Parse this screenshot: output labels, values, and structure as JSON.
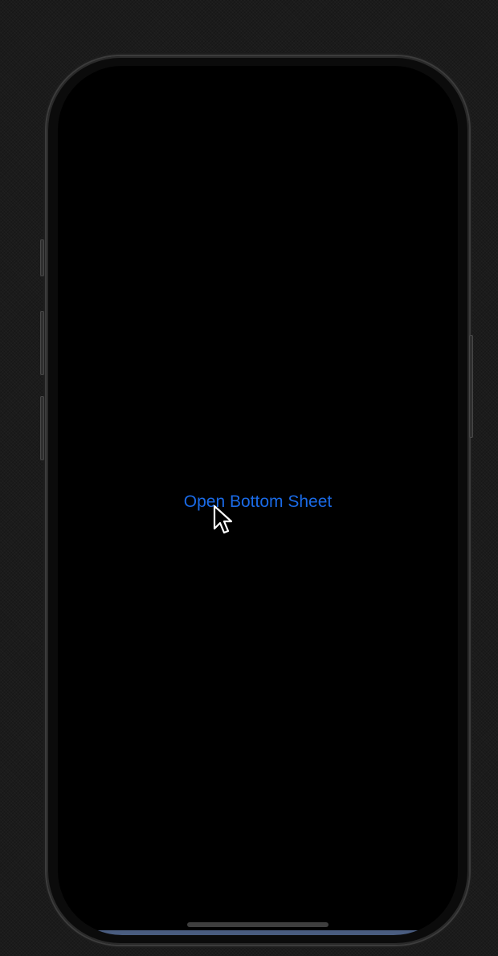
{
  "screen": {
    "background": "#000000",
    "primary_button_label": "Open Bottom Sheet",
    "accent_color": "#1a6ae6"
  },
  "device": {
    "type": "iPhone",
    "frame_color": "#0b0b0b"
  },
  "cursor": {
    "icon": "arrow-pointer-icon"
  }
}
